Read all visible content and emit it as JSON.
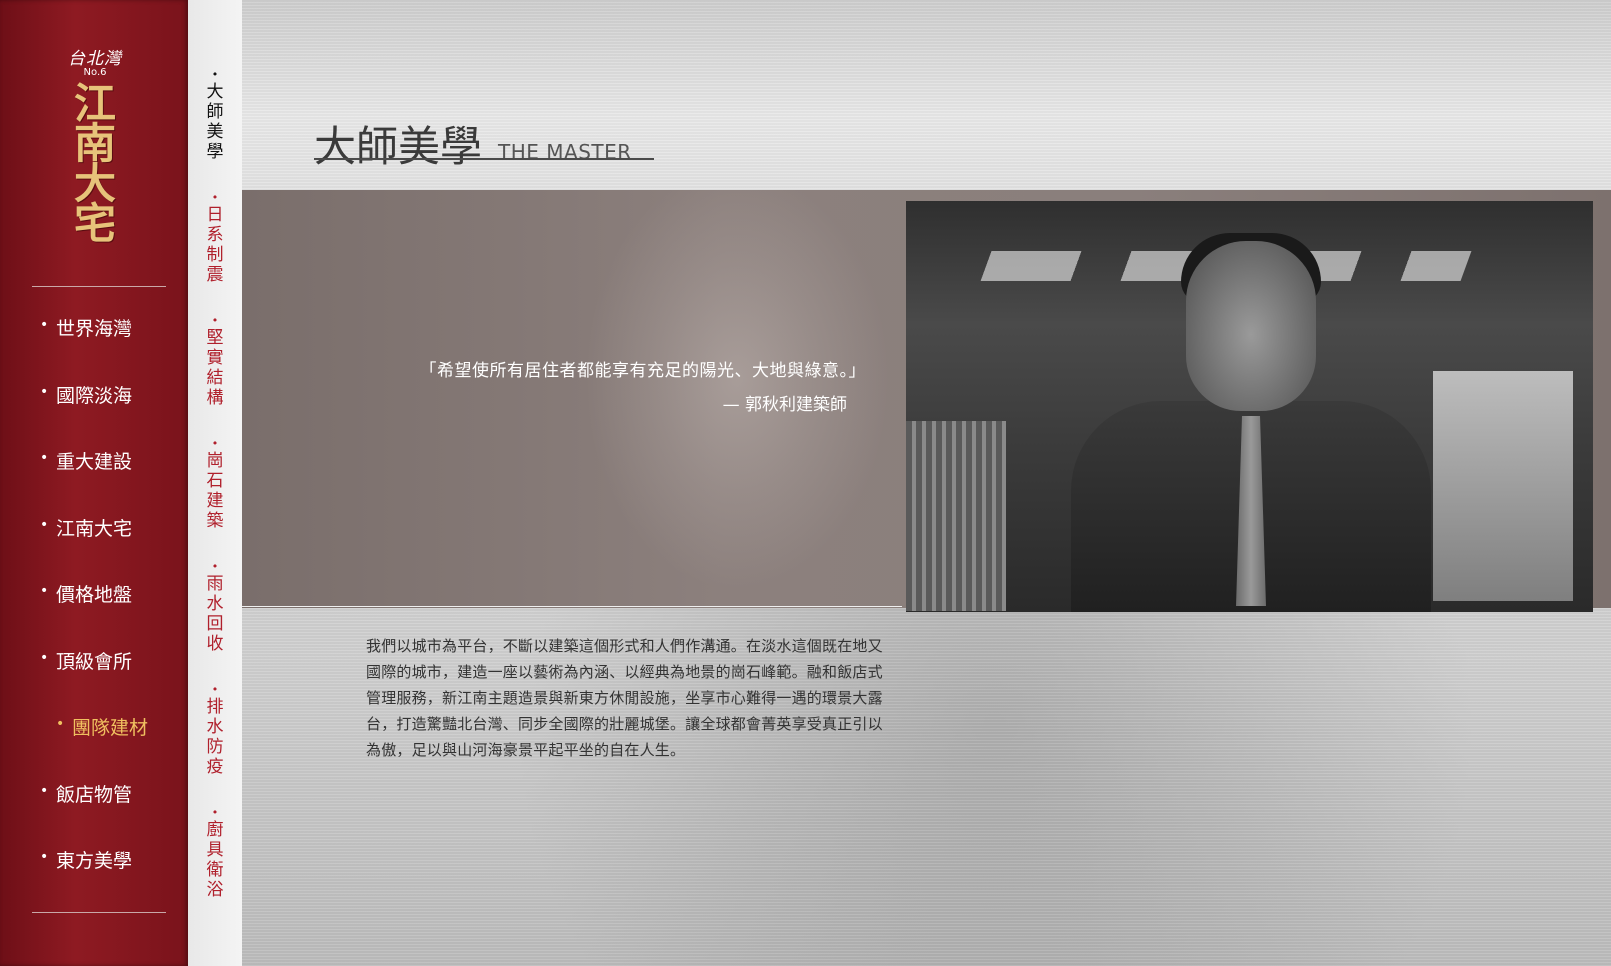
{
  "logo": {
    "city": "台北灣",
    "number": "No.6",
    "name": "江南大宅"
  },
  "nav": {
    "items": [
      {
        "label": "世界海灣",
        "active": false
      },
      {
        "label": "國際淡海",
        "active": false
      },
      {
        "label": "重大建設",
        "active": false
      },
      {
        "label": "江南大宅",
        "active": false
      },
      {
        "label": "價格地盤",
        "active": false
      },
      {
        "label": "頂級會所",
        "active": false
      },
      {
        "label": "團隊建材",
        "active": true
      },
      {
        "label": "飯店物管",
        "active": false
      },
      {
        "label": "東方美學",
        "active": false
      }
    ]
  },
  "subtabs": [
    {
      "label": "大師美學",
      "active": true
    },
    {
      "label": "日系制震",
      "active": false
    },
    {
      "label": "堅實結構",
      "active": false
    },
    {
      "label": "崗石建築",
      "active": false
    },
    {
      "label": "雨水回收",
      "active": false
    },
    {
      "label": "排水防疫",
      "active": false
    },
    {
      "label": "廚具衛浴",
      "active": false
    }
  ],
  "page": {
    "title_cn": "大師美學",
    "title_en": "THE MASTER",
    "quote": "「希望使所有居住者都能享有充足的陽光、大地與綠意。」",
    "quote_author": "— 郭秋利建築師",
    "body": "我們以城市為平台，不斷以建築這個形式和人們作溝通。在淡水這個既在地又國際的城市，建造一座以藝術為內涵、以經典為地景的崗石峰範。融和飯店式管理服務，新江南主題造景與新東方休閒設施，坐享市心難得一遇的環景大露台，打造驚豔北台灣、同步全國際的壯麗城堡。讓全球都會菁英享受真正引以為傲，足以與山河海豪景平起平坐的自在人生。"
  },
  "colors": {
    "sidebar": "#8e1a22",
    "accent_gold": "#f0c060",
    "subtab_red": "#b0202c"
  }
}
